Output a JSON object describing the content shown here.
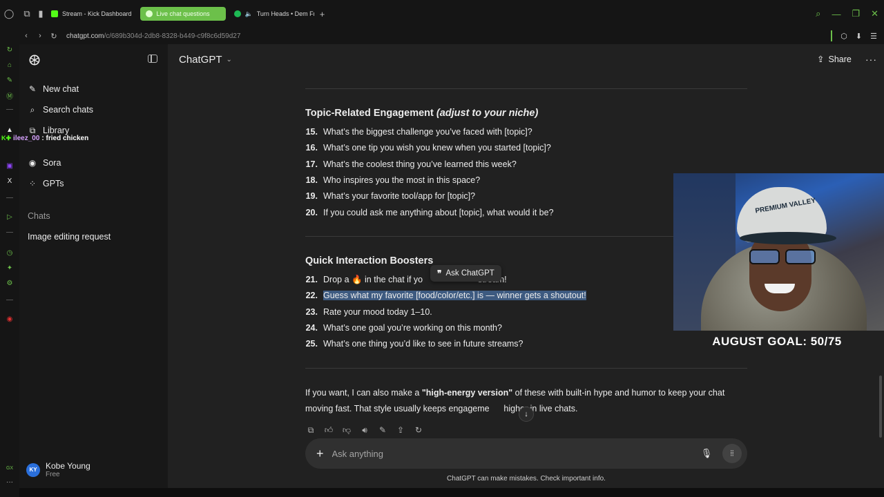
{
  "browser": {
    "tabs": [
      {
        "label": "Stream - Kick Dashboard",
        "fav_color": "#53fc18",
        "active": false
      },
      {
        "label": "Live chat questions",
        "fav_color": "#e0ffd0",
        "active": true
      },
      {
        "label": "Turn Heads • Dem Fra",
        "fav_color": "#1db954",
        "active": false
      }
    ],
    "url_host": "chatgpt.com",
    "url_path": "/c/689b304d-2db8-8328-b449-c9f8c6d59d27"
  },
  "overlay_chat": {
    "user": "ileez_00",
    "message": ": fried chicken"
  },
  "sidebar": {
    "items": [
      {
        "label": "New chat",
        "icon": "pencil-square-icon"
      },
      {
        "label": "Search chats",
        "icon": "search-icon"
      },
      {
        "label": "Library",
        "icon": "library-icon"
      },
      {
        "label": "Sora",
        "icon": "play-circle-icon"
      },
      {
        "label": "GPTs",
        "icon": "grid-icon"
      }
    ],
    "section_label": "Chats",
    "chats": [
      "Image editing request"
    ],
    "user_name": "Kobe Young",
    "user_initials": "KY",
    "user_plan": "Free"
  },
  "header": {
    "title": "ChatGPT",
    "share_label": "Share",
    "more_label": "···"
  },
  "content": {
    "section1_title": "Topic-Related Engagement ",
    "section1_title_em": "(adjust to your niche)",
    "section1_items": [
      {
        "n": "15.",
        "t": "What’s the biggest challenge you’ve faced with [topic]?"
      },
      {
        "n": "16.",
        "t": "What’s one tip you wish you knew when you started [topic]?"
      },
      {
        "n": "17.",
        "t": "What’s the coolest thing you’ve learned this week?"
      },
      {
        "n": "18.",
        "t": "Who inspires you the most in this space?"
      },
      {
        "n": "19.",
        "t": "What’s your favorite tool/app for [topic]?"
      },
      {
        "n": "20.",
        "t": "If you could ask me anything about [topic], what would it be?"
      }
    ],
    "section2_title": "Quick Interaction Boosters",
    "section2_items": [
      {
        "n": "21.",
        "t": "Drop a 🔥 in the chat if yo                       stream!"
      },
      {
        "n": "22.",
        "t": "Guess what my favorite [food/color/etc.] is — winner gets a shoutout!"
      },
      {
        "n": "23.",
        "t": "Rate your mood today 1–10."
      },
      {
        "n": "24.",
        "t": "What’s one goal you’re working on this month?"
      },
      {
        "n": "25.",
        "t": "What’s one thing you’d like to see in future streams?"
      }
    ],
    "ask_popup": "Ask ChatGPT",
    "para_prefix": "If you want, I can also make a ",
    "para_bold": "\"high-energy version\"",
    "para_suffix": " of these with built-in hype and humor to keep your chat moving fast. That style usually keeps engageme      higher in live chats."
  },
  "composer": {
    "placeholder": "Ask anything",
    "disclaimer": "ChatGPT can make mistakes. Check important info."
  },
  "stream_overlay": {
    "cap_text": "PREMIUM VALLEY",
    "goal_text": "AUGUST GOAL: 50/75"
  }
}
